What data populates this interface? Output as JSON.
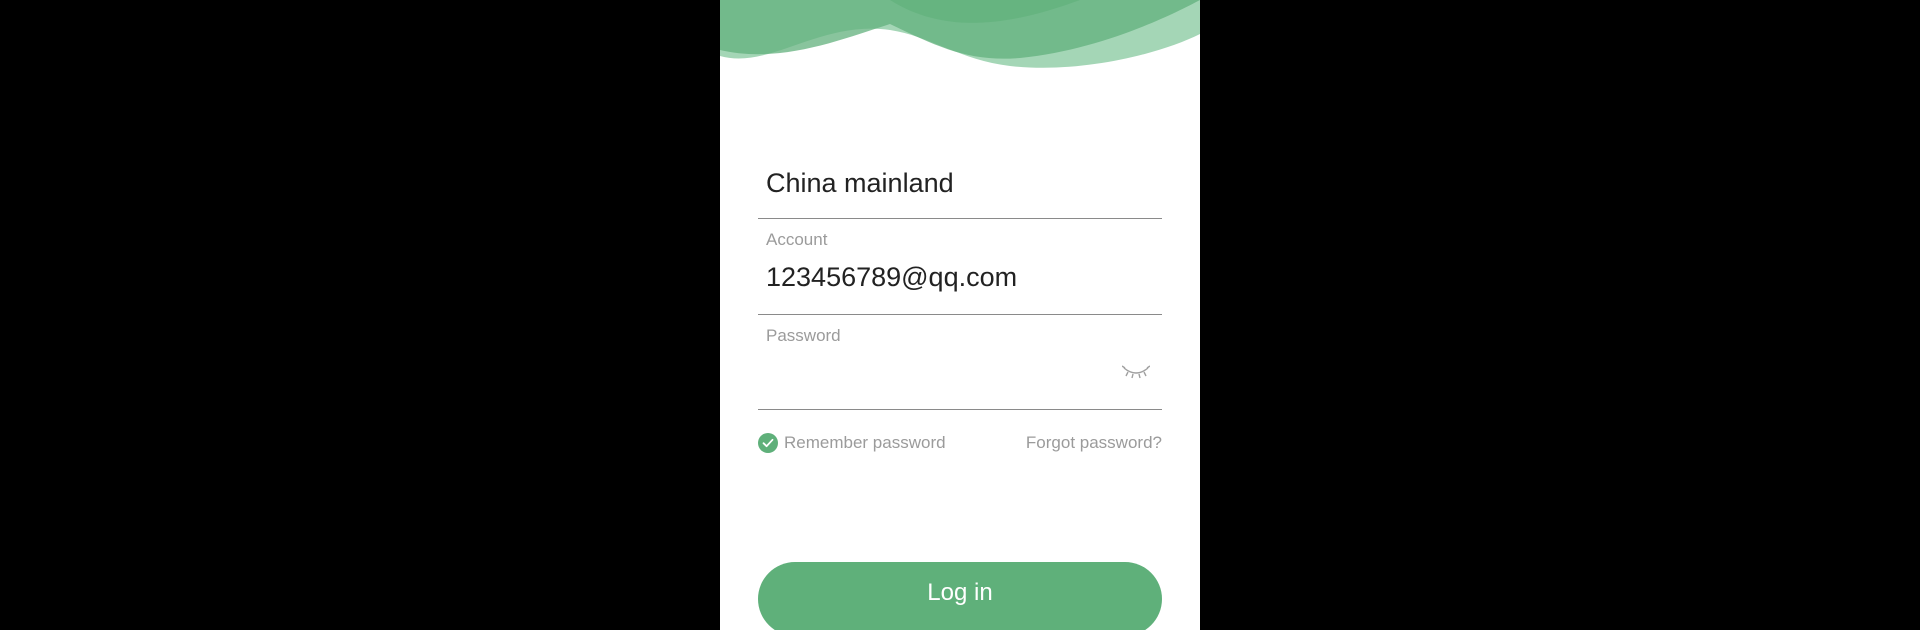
{
  "colors": {
    "accent": "#5fb07a",
    "wave_dark": "#62b07c",
    "wave_light": "#8fcba5",
    "label_gray": "#9b9b9b",
    "text_dark": "#222222",
    "divider": "#8a8a8a",
    "letterbox": "#000000"
  },
  "region": {
    "value": "China mainland"
  },
  "account": {
    "label": "Account",
    "value": "123456789@qq.com"
  },
  "password": {
    "label": "Password",
    "value": "",
    "toggle_icon": "eye-closed-icon"
  },
  "options": {
    "remember_label": "Remember password",
    "remember_checked": true,
    "remember_icon": "check-circle-icon",
    "forgot_label": "Forgot password?"
  },
  "login": {
    "label": "Log in"
  }
}
